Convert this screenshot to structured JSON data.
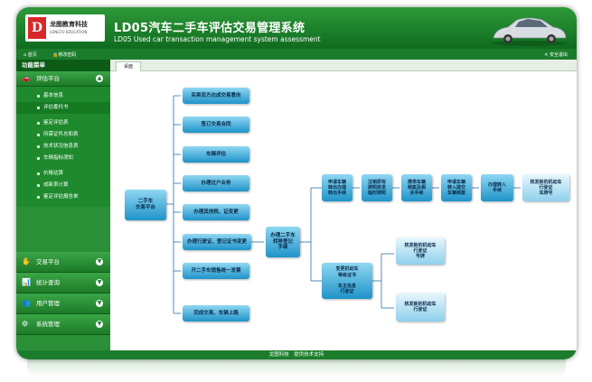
{
  "header": {
    "logo_text": "龙图教育科技",
    "logo_sub": "LONGTU EDUCATION",
    "title_cn": "LD05汽车二手车评估交易管理系统",
    "title_en": "LD05 Used car transaction management system assessment"
  },
  "topbar": {
    "home": "首页",
    "change_password": "修改密码",
    "logout": "安全退出"
  },
  "sidebar": {
    "heading": "功能菜单",
    "groups": [
      {
        "label": "评估平台",
        "icon": "car-icon",
        "expanded": true
      },
      {
        "label": "交易平台",
        "icon": "hand-icon"
      },
      {
        "label": "统计查询",
        "icon": "chart-icon"
      },
      {
        "label": "用户管理",
        "icon": "users-icon"
      },
      {
        "label": "系统管理",
        "icon": "gear-icon"
      }
    ],
    "items": [
      "基本信息",
      "评估委托书",
      "鉴定评估表",
      "所需证件总和表",
      "技术状况信息表",
      "车辆指标须知",
      "价格估算",
      "成新率计算",
      "鉴定评估报告单"
    ],
    "active_item": "评估委托书"
  },
  "tab": {
    "label": "桌面"
  },
  "flow": {
    "start": "二手车\n交易平台",
    "left_steps": [
      "买卖双方达成交易意向",
      "签订交易合同",
      "车辆评估",
      "办理过户业务",
      "办理其他税、证变更",
      "办理行驶证、登记证书变更",
      "开二手车销售统一发票",
      "完成交易、车辆上路"
    ],
    "transfer": "办理二手车\n转移登记\n手续",
    "upper_chain": [
      "申请车辆\n转出办理\n转出手续",
      "注销原有\n牌照核发\n临时牌照",
      "携带车辆\n档案及相\n关手续",
      "申请车辆\n转入提交\n车辆档案",
      "办理转入\n手续",
      "核发新的机动车\n行驶证\n车牌号"
    ],
    "change_owner": "变更机动车\n等级证书\n\n车主信息\n行驶证",
    "right_results": [
      "核发新的机动车\n行驶证\n号牌",
      "核发新的机动车\n行驶证"
    ]
  },
  "footer": {
    "text": "龙图科技　提供技术支持"
  },
  "colors": {
    "green_dark": "#0f6b1f",
    "green": "#2a8f36",
    "box_blue": "#1f93c9"
  }
}
